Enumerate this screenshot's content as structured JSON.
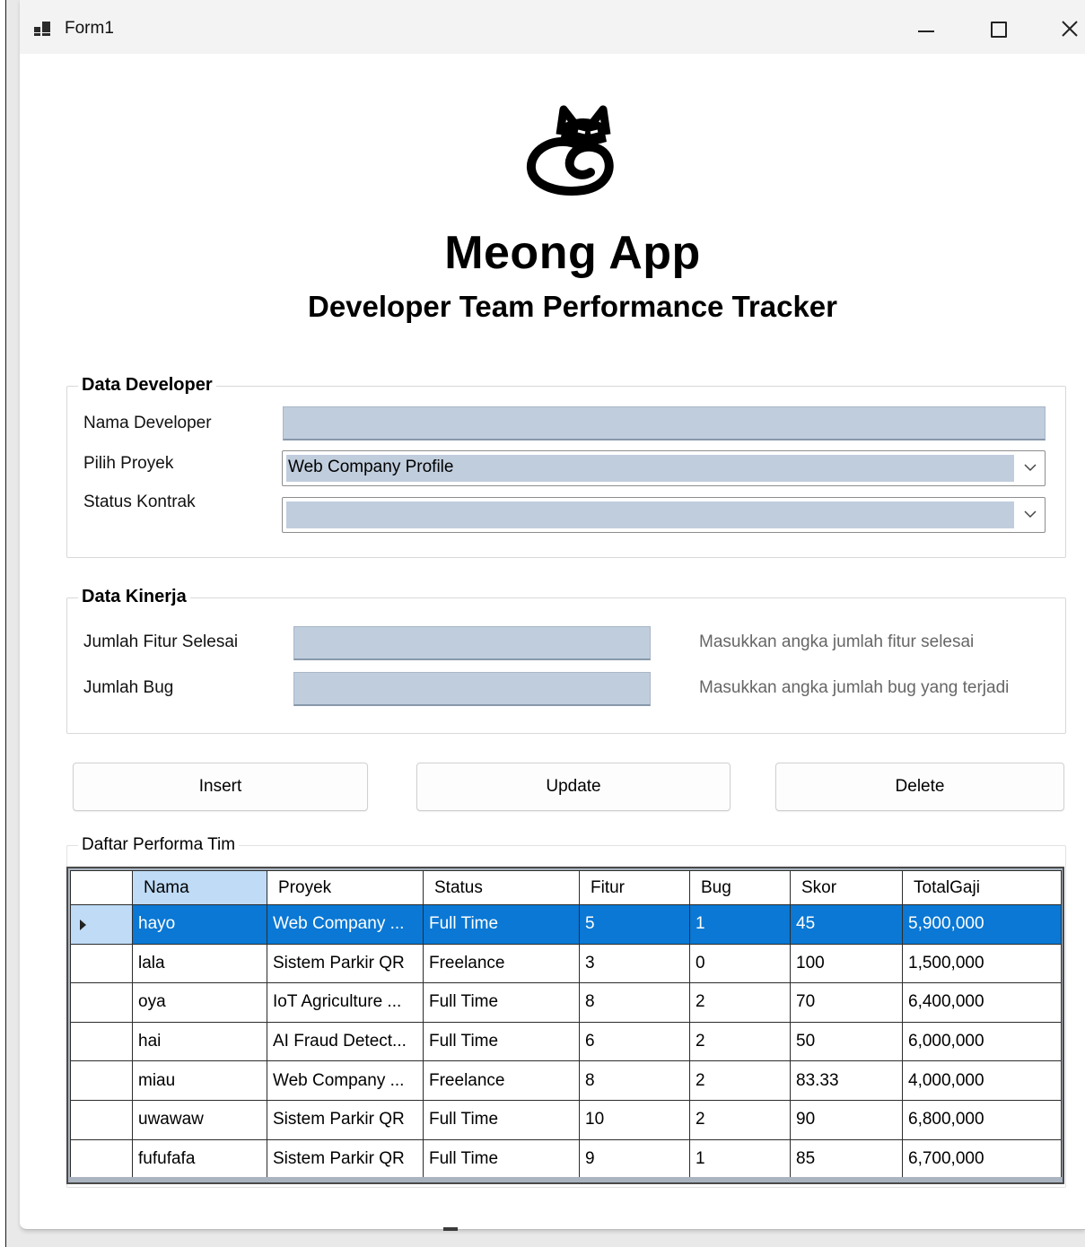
{
  "window": {
    "title": "Form1"
  },
  "header": {
    "app_name": "Meong App",
    "subtitle": "Developer Team Performance Tracker",
    "logo_icon": "cat-spiral-icon"
  },
  "data_developer": {
    "title": "Data Developer",
    "nama_label": "Nama Developer",
    "nama_value": "",
    "proyek_label": "Pilih Proyek",
    "proyek_value": "Web Company Profile",
    "status_label": "Status Kontrak",
    "status_value": ""
  },
  "data_kinerja": {
    "title": "Data Kinerja",
    "fitur_label": "Jumlah Fitur Selesai",
    "fitur_value": "",
    "fitur_hint": "Masukkan angka jumlah fitur selesai",
    "bug_label": "Jumlah Bug",
    "bug_value": "",
    "bug_hint": "Masukkan angka jumlah bug yang terjadi"
  },
  "actions": {
    "insert": "Insert",
    "update": "Update",
    "delete": "Delete"
  },
  "table": {
    "title": "Daftar Performa Tim",
    "columns": [
      "Nama",
      "Proyek",
      "Status",
      "Fitur",
      "Bug",
      "Skor",
      "TotalGaji"
    ],
    "rows": [
      [
        "hayo",
        "Web Company ...",
        "Full Time",
        "5",
        "1",
        "45",
        "5,900,000"
      ],
      [
        "lala",
        "Sistem Parkir QR",
        "Freelance",
        "3",
        "0",
        "100",
        "1,500,000"
      ],
      [
        "oya",
        "IoT Agriculture ...",
        "Full Time",
        "8",
        "2",
        "70",
        "6,400,000"
      ],
      [
        "hai",
        "AI Fraud Detect...",
        "Full Time",
        "6",
        "2",
        "50",
        "6,000,000"
      ],
      [
        "miau",
        "Web Company ...",
        "Freelance",
        "8",
        "2",
        "83.33",
        "4,000,000"
      ],
      [
        "uwawaw",
        "Sistem Parkir QR",
        "Full Time",
        "10",
        "2",
        "90",
        "6,800,000"
      ],
      [
        "fufufafa",
        "Sistem Parkir QR",
        "Full Time",
        "9",
        "1",
        "85",
        "6,700,000"
      ]
    ],
    "selected_row": 0
  },
  "colors": {
    "input_bg": "#c0cddd",
    "selection": "#0a78d4",
    "header_highlight": "#bfdbf6"
  }
}
